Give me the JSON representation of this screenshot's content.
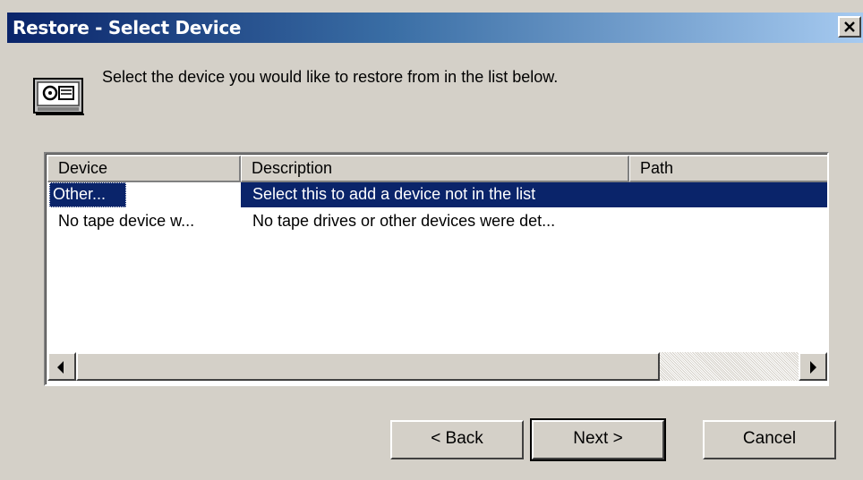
{
  "window": {
    "title": "Restore - Select Device",
    "close_label": "✕"
  },
  "header": {
    "icon": "tape-device-icon",
    "instruction": "Select the device you would like to restore from in the list below."
  },
  "list": {
    "columns": [
      "Device",
      "Description",
      "Path"
    ],
    "rows": [
      {
        "device": "Other...",
        "description": "Select this to add a device not in the list",
        "path": "",
        "selected": true
      },
      {
        "device": "No tape device w...",
        "description": "No tape drives or other devices were det...",
        "path": "",
        "selected": false
      }
    ]
  },
  "buttons": {
    "back": "< Back",
    "next": "Next >",
    "cancel": "Cancel"
  },
  "colors": {
    "selection": "#0a246a",
    "face": "#d4d0c8"
  }
}
